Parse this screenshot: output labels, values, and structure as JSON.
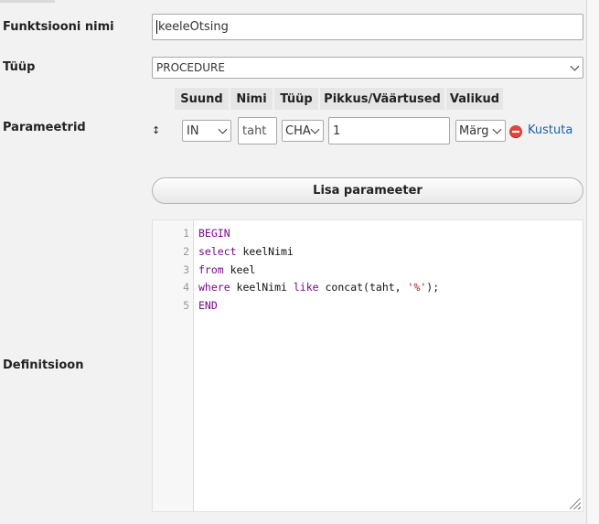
{
  "form": {
    "function_name_label": "Funktsiooni nimi",
    "function_name_value": "keeleOtsing",
    "type_label": "Tüüp",
    "type_value": "PROCEDURE",
    "parameters_label": "Parameetrid",
    "definition_label": "Definitsioon"
  },
  "params": {
    "headers": [
      "Suund",
      "Nimi",
      "Tüüp",
      "Pikkus/Väärtused",
      "Valikud"
    ],
    "row": {
      "sort_handle": "↕",
      "direction": "IN",
      "name": "taht",
      "type": "CHA",
      "length": "1",
      "options": "Märg",
      "delete_label": "Kustuta"
    },
    "add_button": "Lisa parameeter"
  },
  "editor": {
    "line_numbers": [
      "1",
      "2",
      "3",
      "4",
      "5"
    ],
    "lines": [
      [
        {
          "t": "BEGIN",
          "k": "kw"
        }
      ],
      [
        {
          "t": "select",
          "k": "kw"
        },
        {
          "t": " keelNimi",
          "k": ""
        }
      ],
      [
        {
          "t": "from",
          "k": "kw"
        },
        {
          "t": " keel",
          "k": ""
        }
      ],
      [
        {
          "t": "where",
          "k": "kw"
        },
        {
          "t": " keelNimi ",
          "k": ""
        },
        {
          "t": "like",
          "k": "kw"
        },
        {
          "t": " concat(taht, ",
          "k": ""
        },
        {
          "t": "'%'",
          "k": "str"
        },
        {
          "t": ");",
          "k": ""
        }
      ],
      [
        {
          "t": "END",
          "k": "kw"
        }
      ]
    ]
  },
  "colors": {
    "keyword": "#77088a",
    "string": "#b01818",
    "link": "#1a5fa8",
    "delete": "#e0463c"
  }
}
